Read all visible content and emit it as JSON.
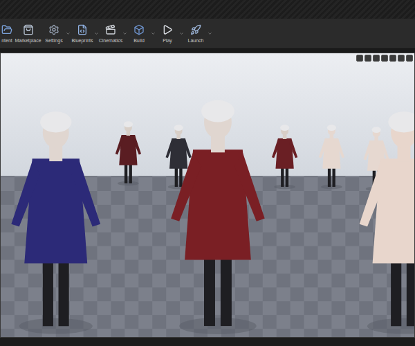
{
  "toolbar": {
    "buttons": [
      {
        "label": "ntent",
        "dropdown": false
      },
      {
        "label": "Marketplace",
        "dropdown": false
      },
      {
        "label": "Settings",
        "dropdown": true
      },
      {
        "label": "Blueprints",
        "dropdown": true
      },
      {
        "label": "Cinematics",
        "dropdown": true
      },
      {
        "label": "Build",
        "dropdown": true
      },
      {
        "label": "Play",
        "dropdown": true
      },
      {
        "label": "Launch",
        "dropdown": true
      }
    ]
  }
}
